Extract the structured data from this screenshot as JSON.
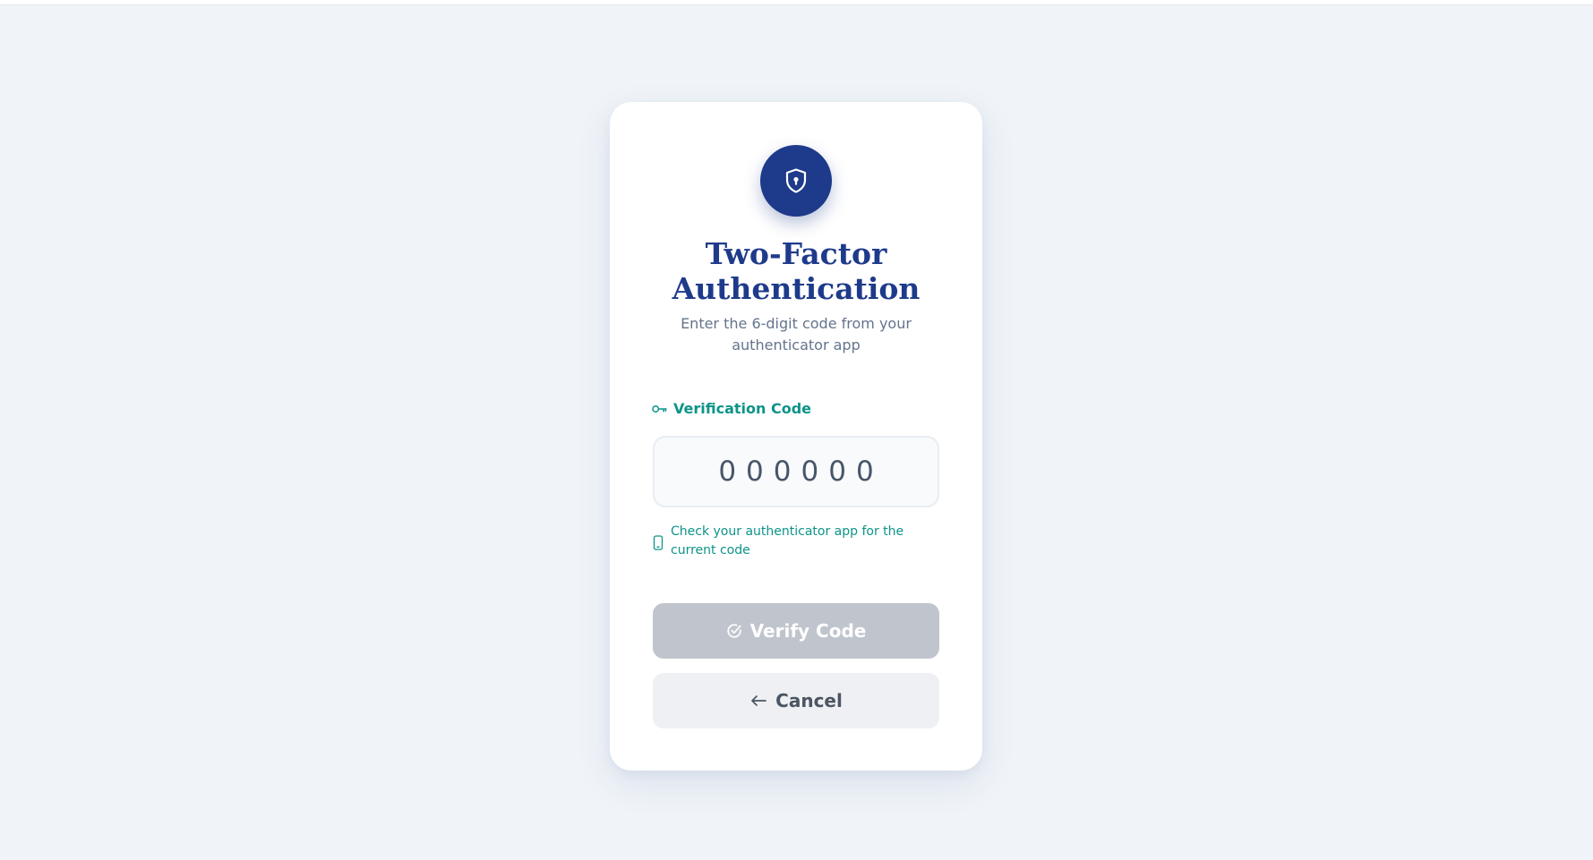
{
  "page": {
    "title": "Two-Factor Authentication",
    "subtitle": "Enter the 6-digit code from your authenticator app"
  },
  "form": {
    "label": "Verification Code",
    "code_value": "",
    "code_placeholder": "000000",
    "hint": "Check your authenticator app for the current code"
  },
  "actions": {
    "verify_label": "Verify Code",
    "cancel_label": "Cancel"
  },
  "icons": {
    "badge": "shield-lock-icon",
    "label": "key-icon",
    "hint": "smartphone-icon",
    "verify": "check-circle-icon",
    "cancel": "arrow-left-icon"
  },
  "colors": {
    "background": "#f0f4f8",
    "primary": "#1e3a8a",
    "accent": "#0d9488",
    "button_disabled": "#c0c5cd",
    "button_secondary": "#eef0f3"
  }
}
